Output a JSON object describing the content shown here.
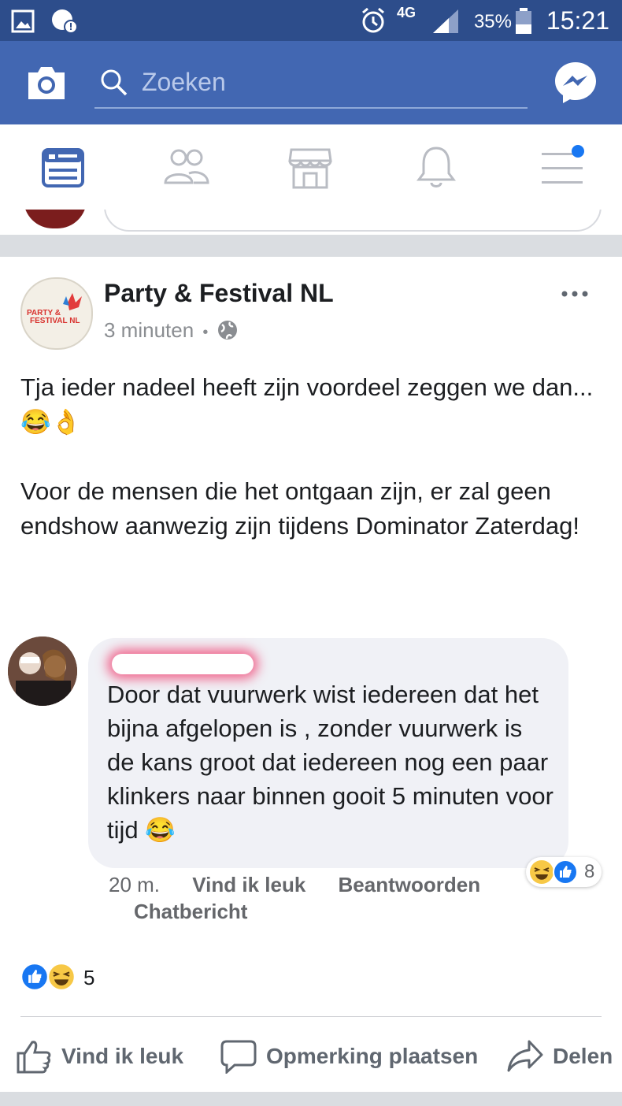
{
  "status_bar": {
    "network": "4G",
    "battery": "35%",
    "time": "15:21"
  },
  "search": {
    "placeholder": "Zoeken"
  },
  "post": {
    "page_name": "Party & Festival NL",
    "logo_text_1": "PARTY &",
    "logo_text_2": "FESTIVAL NL",
    "time": "3 minuten",
    "separator": "•",
    "text_1": "Tja ieder nadeel heeft zijn voordeel zeggen we dan...😂👌",
    "text_2": "Voor de mensen die het ontgaan zijn, er zal geen endshow aanwezig zijn tijdens Dominator Zaterdag!",
    "reactions_count": "5"
  },
  "comment": {
    "text": "Door dat vuurwerk wist iedereen dat het bijna afgelopen is , zonder vuurwerk is de kans groot dat iedereen nog een paar klinkers naar binnen gooit 5 minuten voor tijd 😂",
    "time": "20 m.",
    "like": "Vind ik leuk",
    "reply": "Beantwoorden",
    "message": "Chatbericht",
    "reactions_count": "8"
  },
  "actions": {
    "like": "Vind ik leuk",
    "comment": "Opmerking plaatsen",
    "share": "Delen"
  },
  "colors": {
    "brand": "#4267b2",
    "status": "#2d4d8b",
    "like_blue": "#1877f2",
    "haha_yellow": "#f7c846"
  }
}
